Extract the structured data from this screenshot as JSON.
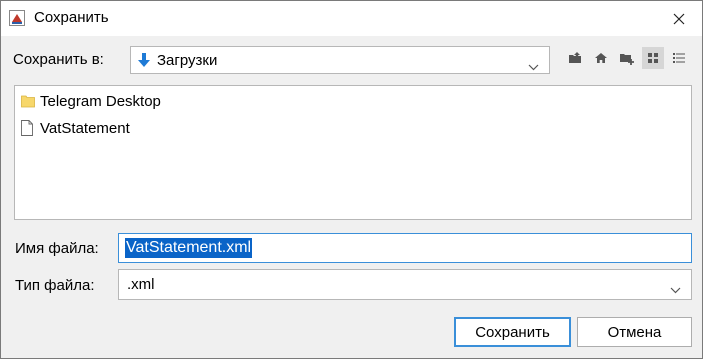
{
  "window": {
    "title": "Сохранить"
  },
  "lookin": {
    "label": "Сохранить в:",
    "folder": "Загрузки"
  },
  "toolbar": {
    "icons": [
      "up-folder-icon",
      "home-icon",
      "new-folder-icon",
      "list-view-icon",
      "details-view-icon"
    ]
  },
  "files": [
    {
      "name": "Telegram Desktop",
      "type": "folder"
    },
    {
      "name": "VatStatement",
      "type": "file"
    }
  ],
  "filename": {
    "label": "Имя файла:",
    "value": "VatStatement.xml"
  },
  "filetype": {
    "label": "Тип файла:",
    "value": ".xml"
  },
  "buttons": {
    "save": "Сохранить",
    "cancel": "Отмена"
  },
  "colors": {
    "accent": "#0a64c8",
    "focus_border": "#3a8fd9",
    "folder": "#f7d76b"
  }
}
